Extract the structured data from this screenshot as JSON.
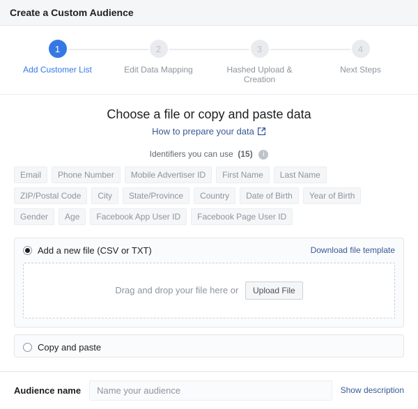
{
  "header": {
    "title": "Create a Custom Audience"
  },
  "steps": [
    {
      "num": "1",
      "label": "Add Customer List"
    },
    {
      "num": "2",
      "label": "Edit Data Mapping"
    },
    {
      "num": "3",
      "label": "Hashed Upload & Creation"
    },
    {
      "num": "4",
      "label": "Next Steps"
    }
  ],
  "main": {
    "title": "Choose a file or copy and paste data",
    "help_link": "How to prepare your data",
    "identifiers_label": "Identifiers you can use",
    "identifiers_count": "(15)",
    "tags": [
      "Email",
      "Phone Number",
      "Mobile Advertiser ID",
      "First Name",
      "Last Name",
      "ZIP/Postal Code",
      "City",
      "State/Province",
      "Country",
      "Date of Birth",
      "Year of Birth",
      "Gender",
      "Age",
      "Facebook App User ID",
      "Facebook Page User ID"
    ]
  },
  "upload": {
    "option_label": "Add a new file (CSV or TXT)",
    "download_template": "Download file template",
    "drop_prefix": "Drag and drop your file here or",
    "upload_button": "Upload File"
  },
  "paste": {
    "option_label": "Copy and paste"
  },
  "footer": {
    "label": "Audience name",
    "placeholder": "Name your audience",
    "show_description": "Show description"
  }
}
